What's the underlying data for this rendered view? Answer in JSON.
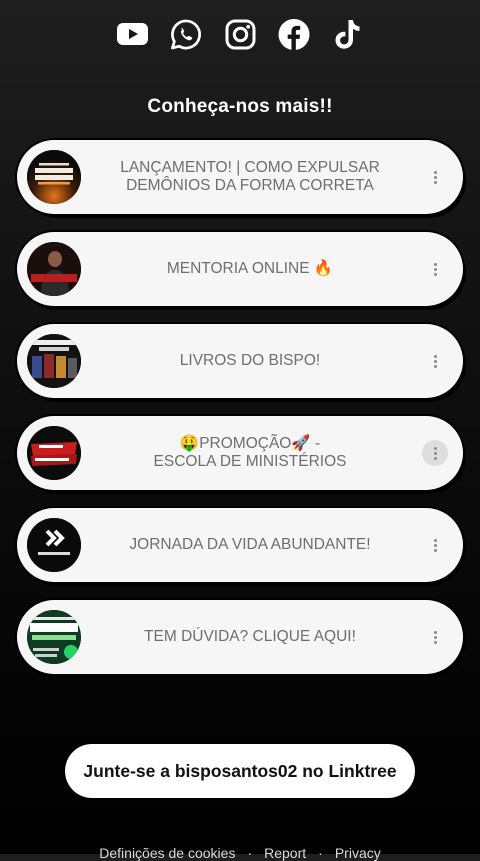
{
  "socials": [
    {
      "icon": "youtube-icon"
    },
    {
      "icon": "whatsapp-icon"
    },
    {
      "icon": "instagram-icon"
    },
    {
      "icon": "facebook-icon"
    },
    {
      "icon": "tiktok-icon"
    }
  ],
  "heading": "Conheça-nos mais!!",
  "links": [
    {
      "line1": "LANÇAMENTO! | COMO EXPULSAR",
      "line2": "DEMÔNIOS DA FORMA CORRETA",
      "thumb_text": "COMO EXPULSAR DEMÔNIOS"
    },
    {
      "line1": "MENTORIA ONLINE 🔥",
      "line2": "",
      "thumb_text": "MENTORIA"
    },
    {
      "line1": "LIVROS DO BISPO!",
      "line2": "",
      "thumb_text": "TUDO EM UM SÓ LUGAR"
    },
    {
      "line1": "🤑PROMOÇÃO🚀 -",
      "line2": "ESCOLA DE MINISTÉRIOS",
      "thumb_text": "ESCOLA MINISTÉRIOS"
    },
    {
      "line1": "JORNADA DA VIDA ABUNDANTE!",
      "line2": "",
      "thumb_text": "AVANÇAR"
    },
    {
      "line1": "TEM DÚVIDA? CLIQUE AQUI!",
      "line2": "",
      "thumb_text": "LISTA VIP WHATSAPP"
    }
  ],
  "join_button": "Junte-se a bisposantos02 no Linktree",
  "footer": {
    "cookies": "Definições de cookies",
    "report": "Report",
    "privacy": "Privacy",
    "separator": "·"
  }
}
